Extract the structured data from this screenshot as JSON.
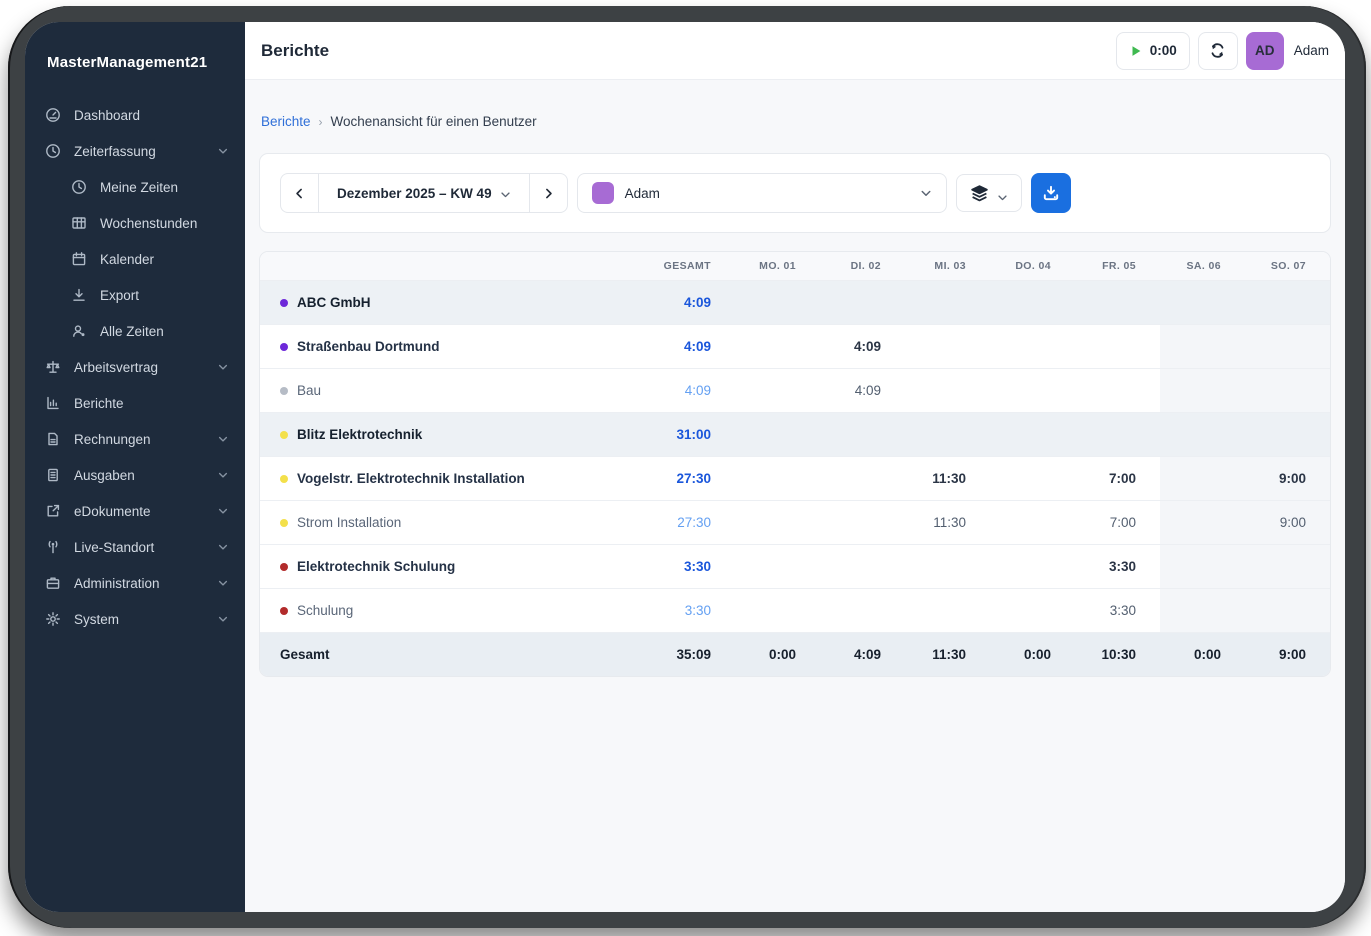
{
  "brand": "MasterManagement21",
  "colors": {
    "accent_blue": "#1a6fe0",
    "timer_green": "#3fb950",
    "avatar_purple": "#a76bd4",
    "value_blue_strong": "#1a56db",
    "value_blue_light": "#64a0f2"
  },
  "sidebar": {
    "items": [
      {
        "label": "Dashboard",
        "icon": "dashboard-icon",
        "sub": false,
        "chevron": false
      },
      {
        "label": "Zeiterfassung",
        "icon": "clock-icon",
        "sub": false,
        "chevron": true
      },
      {
        "label": "Meine Zeiten",
        "icon": "clock-icon",
        "sub": true,
        "chevron": false
      },
      {
        "label": "Wochenstunden",
        "icon": "table-icon",
        "sub": true,
        "chevron": false
      },
      {
        "label": "Kalender",
        "icon": "calendar-icon",
        "sub": true,
        "chevron": false
      },
      {
        "label": "Export",
        "icon": "download-icon",
        "sub": true,
        "chevron": false
      },
      {
        "label": "Alle Zeiten",
        "icon": "users-icon",
        "sub": true,
        "chevron": false
      },
      {
        "label": "Arbeitsvertrag",
        "icon": "scale-icon",
        "sub": false,
        "chevron": true
      },
      {
        "label": "Berichte",
        "icon": "report-icon",
        "sub": false,
        "chevron": false
      },
      {
        "label": "Rechnungen",
        "icon": "invoice-icon",
        "sub": false,
        "chevron": true
      },
      {
        "label": "Ausgaben",
        "icon": "document-icon",
        "sub": false,
        "chevron": true
      },
      {
        "label": "eDokumente",
        "icon": "external-link-icon",
        "sub": false,
        "chevron": true
      },
      {
        "label": "Live-Standort",
        "icon": "signal-icon",
        "sub": false,
        "chevron": true
      },
      {
        "label": "Administration",
        "icon": "briefcase-icon",
        "sub": false,
        "chevron": true
      },
      {
        "label": "System",
        "icon": "gear-icon",
        "sub": false,
        "chevron": true
      }
    ]
  },
  "header": {
    "title": "Berichte",
    "timer_value": "0:00",
    "avatar_initials": "AD",
    "user_name": "Adam"
  },
  "breadcrumb": {
    "link": "Berichte",
    "separator": "›",
    "current": "Wochenansicht für einen Benutzer"
  },
  "toolbar": {
    "week_label": "Dezember 2025 – KW 49",
    "user_select_value": "Adam",
    "user_select_color": "#a76bd4"
  },
  "table": {
    "columns": [
      "GESAMT",
      "MO. 01",
      "DI. 02",
      "MI. 03",
      "DO. 04",
      "FR. 05",
      "SA. 06",
      "SO. 07"
    ],
    "weekend_columns": [
      "SA. 06",
      "SO. 07"
    ],
    "rows": [
      {
        "label": "ABC GmbH",
        "level": "company",
        "dot_color": "#6d28d9",
        "values": [
          "4:09",
          "",
          "",
          "",
          "",
          "",
          "",
          ""
        ]
      },
      {
        "label": "Straßenbau Dortmund",
        "level": "project",
        "dot_color": "#6d28d9",
        "values": [
          "4:09",
          "",
          "4:09",
          "",
          "",
          "",
          "",
          ""
        ]
      },
      {
        "label": "Bau",
        "level": "task",
        "dot_color": "#b6bcc6",
        "values": [
          "4:09",
          "",
          "4:09",
          "",
          "",
          "",
          "",
          ""
        ]
      },
      {
        "label": "Blitz Elektrotechnik",
        "level": "company",
        "dot_color": "#f3e04b",
        "values": [
          "31:00",
          "",
          "",
          "",
          "",
          "",
          "",
          ""
        ]
      },
      {
        "label": "Vogelstr. Elektrotechnik Installation",
        "level": "project",
        "dot_color": "#f3e04b",
        "values": [
          "27:30",
          "",
          "",
          "11:30",
          "",
          "7:00",
          "",
          "9:00"
        ]
      },
      {
        "label": "Strom Installation",
        "level": "task",
        "dot_color": "#f3e04b",
        "values": [
          "27:30",
          "",
          "",
          "11:30",
          "",
          "7:00",
          "",
          "9:00"
        ]
      },
      {
        "label": "Elektrotechnik Schulung",
        "level": "project",
        "dot_color": "#b22b2b",
        "values": [
          "3:30",
          "",
          "",
          "",
          "",
          "3:30",
          "",
          ""
        ]
      },
      {
        "label": "Schulung",
        "level": "task",
        "dot_color": "#b22b2b",
        "values": [
          "3:30",
          "",
          "",
          "",
          "",
          "3:30",
          "",
          ""
        ]
      }
    ],
    "footer": {
      "label": "Gesamt",
      "values": [
        "35:09",
        "0:00",
        "4:09",
        "11:30",
        "0:00",
        "10:30",
        "0:00",
        "9:00"
      ]
    }
  }
}
